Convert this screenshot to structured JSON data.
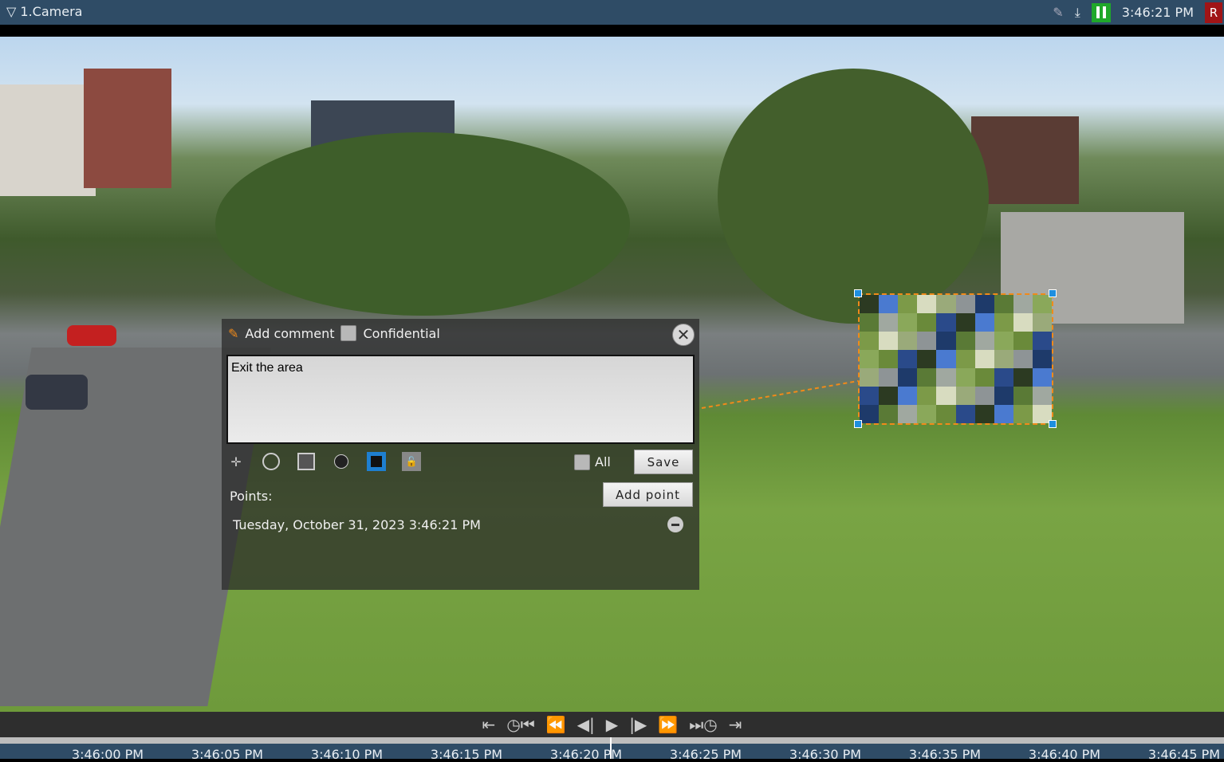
{
  "header": {
    "title": "1.Camera",
    "time": "3:46:21 PM",
    "record_label": "R"
  },
  "dialog": {
    "title": "Add comment",
    "confidential_label": "Confidential",
    "comment": "Exit the area",
    "all_label": "All",
    "save_label": "Save",
    "add_point_label": "Add point",
    "points_label": "Points:",
    "points": [
      {
        "timestamp": "Tuesday, October 31, 2023 3:46:21 PM"
      }
    ]
  },
  "timeline": {
    "ticks": [
      "3:46:00 PM",
      "3:46:05 PM",
      "3:46:10 PM",
      "3:46:15 PM",
      "3:46:20 PM",
      "3:46:25 PM",
      "3:46:30 PM",
      "3:46:35 PM",
      "3:46:40 PM",
      "3:46:45 PM"
    ]
  },
  "colors": {
    "accent": "#1e8fe0",
    "mask_border": "#f08a1a",
    "play_status": "#1fa82a",
    "record": "#a01416"
  }
}
